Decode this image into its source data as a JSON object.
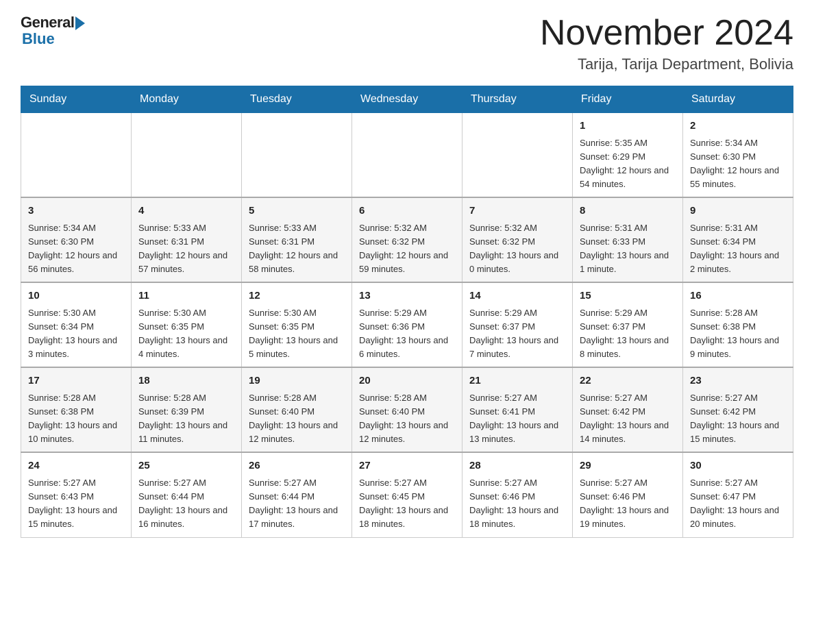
{
  "header": {
    "logo_text": "General",
    "logo_blue": "Blue",
    "month_title": "November 2024",
    "location": "Tarija, Tarija Department, Bolivia"
  },
  "days_of_week": [
    "Sunday",
    "Monday",
    "Tuesday",
    "Wednesday",
    "Thursday",
    "Friday",
    "Saturday"
  ],
  "weeks": [
    [
      {
        "day": "",
        "sunrise": "",
        "sunset": "",
        "daylight": ""
      },
      {
        "day": "",
        "sunrise": "",
        "sunset": "",
        "daylight": ""
      },
      {
        "day": "",
        "sunrise": "",
        "sunset": "",
        "daylight": ""
      },
      {
        "day": "",
        "sunrise": "",
        "sunset": "",
        "daylight": ""
      },
      {
        "day": "",
        "sunrise": "",
        "sunset": "",
        "daylight": ""
      },
      {
        "day": "1",
        "sunrise": "Sunrise: 5:35 AM",
        "sunset": "Sunset: 6:29 PM",
        "daylight": "Daylight: 12 hours and 54 minutes."
      },
      {
        "day": "2",
        "sunrise": "Sunrise: 5:34 AM",
        "sunset": "Sunset: 6:30 PM",
        "daylight": "Daylight: 12 hours and 55 minutes."
      }
    ],
    [
      {
        "day": "3",
        "sunrise": "Sunrise: 5:34 AM",
        "sunset": "Sunset: 6:30 PM",
        "daylight": "Daylight: 12 hours and 56 minutes."
      },
      {
        "day": "4",
        "sunrise": "Sunrise: 5:33 AM",
        "sunset": "Sunset: 6:31 PM",
        "daylight": "Daylight: 12 hours and 57 minutes."
      },
      {
        "day": "5",
        "sunrise": "Sunrise: 5:33 AM",
        "sunset": "Sunset: 6:31 PM",
        "daylight": "Daylight: 12 hours and 58 minutes."
      },
      {
        "day": "6",
        "sunrise": "Sunrise: 5:32 AM",
        "sunset": "Sunset: 6:32 PM",
        "daylight": "Daylight: 12 hours and 59 minutes."
      },
      {
        "day": "7",
        "sunrise": "Sunrise: 5:32 AM",
        "sunset": "Sunset: 6:32 PM",
        "daylight": "Daylight: 13 hours and 0 minutes."
      },
      {
        "day": "8",
        "sunrise": "Sunrise: 5:31 AM",
        "sunset": "Sunset: 6:33 PM",
        "daylight": "Daylight: 13 hours and 1 minute."
      },
      {
        "day": "9",
        "sunrise": "Sunrise: 5:31 AM",
        "sunset": "Sunset: 6:34 PM",
        "daylight": "Daylight: 13 hours and 2 minutes."
      }
    ],
    [
      {
        "day": "10",
        "sunrise": "Sunrise: 5:30 AM",
        "sunset": "Sunset: 6:34 PM",
        "daylight": "Daylight: 13 hours and 3 minutes."
      },
      {
        "day": "11",
        "sunrise": "Sunrise: 5:30 AM",
        "sunset": "Sunset: 6:35 PM",
        "daylight": "Daylight: 13 hours and 4 minutes."
      },
      {
        "day": "12",
        "sunrise": "Sunrise: 5:30 AM",
        "sunset": "Sunset: 6:35 PM",
        "daylight": "Daylight: 13 hours and 5 minutes."
      },
      {
        "day": "13",
        "sunrise": "Sunrise: 5:29 AM",
        "sunset": "Sunset: 6:36 PM",
        "daylight": "Daylight: 13 hours and 6 minutes."
      },
      {
        "day": "14",
        "sunrise": "Sunrise: 5:29 AM",
        "sunset": "Sunset: 6:37 PM",
        "daylight": "Daylight: 13 hours and 7 minutes."
      },
      {
        "day": "15",
        "sunrise": "Sunrise: 5:29 AM",
        "sunset": "Sunset: 6:37 PM",
        "daylight": "Daylight: 13 hours and 8 minutes."
      },
      {
        "day": "16",
        "sunrise": "Sunrise: 5:28 AM",
        "sunset": "Sunset: 6:38 PM",
        "daylight": "Daylight: 13 hours and 9 minutes."
      }
    ],
    [
      {
        "day": "17",
        "sunrise": "Sunrise: 5:28 AM",
        "sunset": "Sunset: 6:38 PM",
        "daylight": "Daylight: 13 hours and 10 minutes."
      },
      {
        "day": "18",
        "sunrise": "Sunrise: 5:28 AM",
        "sunset": "Sunset: 6:39 PM",
        "daylight": "Daylight: 13 hours and 11 minutes."
      },
      {
        "day": "19",
        "sunrise": "Sunrise: 5:28 AM",
        "sunset": "Sunset: 6:40 PM",
        "daylight": "Daylight: 13 hours and 12 minutes."
      },
      {
        "day": "20",
        "sunrise": "Sunrise: 5:28 AM",
        "sunset": "Sunset: 6:40 PM",
        "daylight": "Daylight: 13 hours and 12 minutes."
      },
      {
        "day": "21",
        "sunrise": "Sunrise: 5:27 AM",
        "sunset": "Sunset: 6:41 PM",
        "daylight": "Daylight: 13 hours and 13 minutes."
      },
      {
        "day": "22",
        "sunrise": "Sunrise: 5:27 AM",
        "sunset": "Sunset: 6:42 PM",
        "daylight": "Daylight: 13 hours and 14 minutes."
      },
      {
        "day": "23",
        "sunrise": "Sunrise: 5:27 AM",
        "sunset": "Sunset: 6:42 PM",
        "daylight": "Daylight: 13 hours and 15 minutes."
      }
    ],
    [
      {
        "day": "24",
        "sunrise": "Sunrise: 5:27 AM",
        "sunset": "Sunset: 6:43 PM",
        "daylight": "Daylight: 13 hours and 15 minutes."
      },
      {
        "day": "25",
        "sunrise": "Sunrise: 5:27 AM",
        "sunset": "Sunset: 6:44 PM",
        "daylight": "Daylight: 13 hours and 16 minutes."
      },
      {
        "day": "26",
        "sunrise": "Sunrise: 5:27 AM",
        "sunset": "Sunset: 6:44 PM",
        "daylight": "Daylight: 13 hours and 17 minutes."
      },
      {
        "day": "27",
        "sunrise": "Sunrise: 5:27 AM",
        "sunset": "Sunset: 6:45 PM",
        "daylight": "Daylight: 13 hours and 18 minutes."
      },
      {
        "day": "28",
        "sunrise": "Sunrise: 5:27 AM",
        "sunset": "Sunset: 6:46 PM",
        "daylight": "Daylight: 13 hours and 18 minutes."
      },
      {
        "day": "29",
        "sunrise": "Sunrise: 5:27 AM",
        "sunset": "Sunset: 6:46 PM",
        "daylight": "Daylight: 13 hours and 19 minutes."
      },
      {
        "day": "30",
        "sunrise": "Sunrise: 5:27 AM",
        "sunset": "Sunset: 6:47 PM",
        "daylight": "Daylight: 13 hours and 20 minutes."
      }
    ]
  ]
}
